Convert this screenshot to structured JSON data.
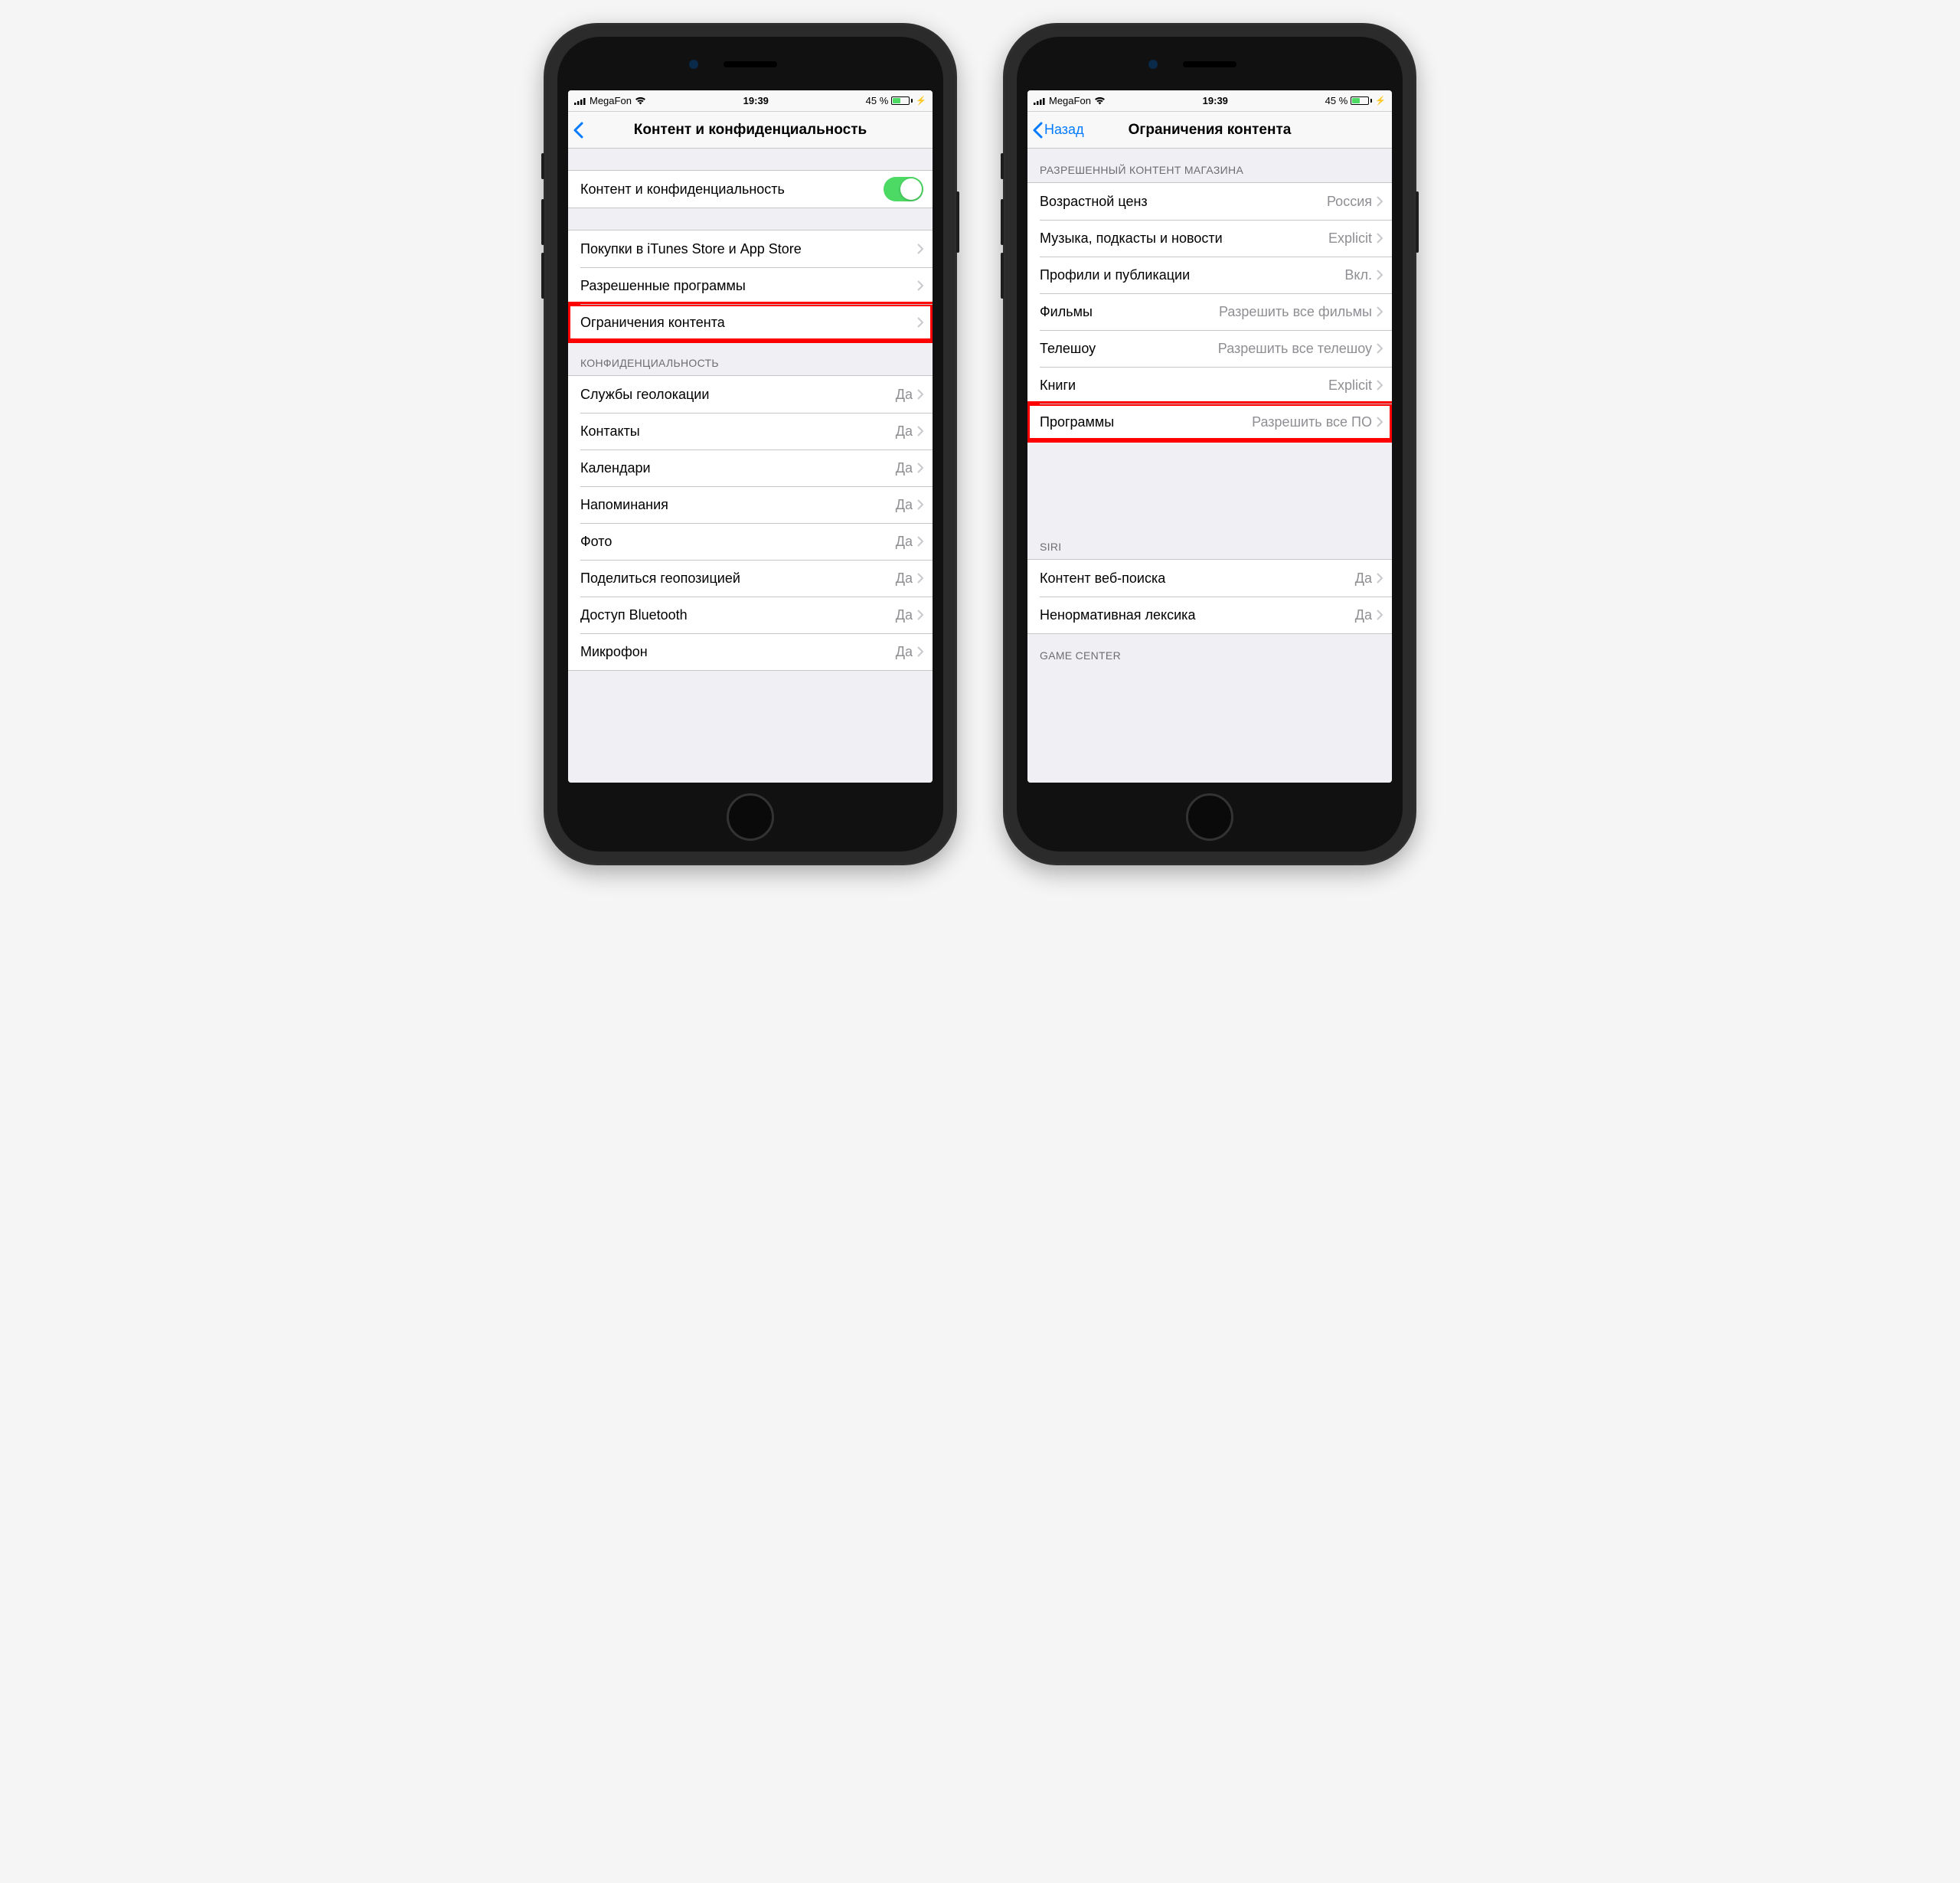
{
  "status": {
    "carrier": "MegaFon",
    "time": "19:39",
    "battery_pct": "45 %"
  },
  "phone1": {
    "nav": {
      "title": "Контент и конфиденциальность"
    },
    "toggle_row": {
      "label": "Контент и конфиденциальность"
    },
    "group2": [
      {
        "label": "Покупки в iTunes Store и App Store"
      },
      {
        "label": "Разрешенные программы"
      },
      {
        "label": "Ограничения контента",
        "highlight": true
      }
    ],
    "privacy_header": "КОНФИДЕНЦИАЛЬНОСТЬ",
    "privacy_rows": [
      {
        "label": "Службы геолокации",
        "value": "Да"
      },
      {
        "label": "Контакты",
        "value": "Да"
      },
      {
        "label": "Календари",
        "value": "Да"
      },
      {
        "label": "Напоминания",
        "value": "Да"
      },
      {
        "label": "Фото",
        "value": "Да"
      },
      {
        "label": "Поделиться геопозицией",
        "value": "Да"
      },
      {
        "label": "Доступ Bluetooth",
        "value": "Да"
      },
      {
        "label": "Микрофон",
        "value": "Да"
      }
    ]
  },
  "phone2": {
    "nav": {
      "back": "Назад",
      "title": "Ограничения контента"
    },
    "store_header": "РАЗРЕШЕННЫЙ КОНТЕНТ МАГАЗИНА",
    "store_rows": [
      {
        "label": "Возрастной ценз",
        "value": "Россия"
      },
      {
        "label": "Музыка, подкасты и новости",
        "value": "Explicit"
      },
      {
        "label": "Профили и публикации",
        "value": "Вкл."
      },
      {
        "label": "Фильмы",
        "value": "Разрешить все фильмы"
      },
      {
        "label": "Телешоу",
        "value": "Разрешить все телешоу"
      },
      {
        "label": "Книги",
        "value": "Explicit"
      },
      {
        "label": "Программы",
        "value": "Разрешить все ПО",
        "highlight": true
      }
    ],
    "siri_header": "SIRI",
    "siri_rows": [
      {
        "label": "Контент веб-поиска",
        "value": "Да"
      },
      {
        "label": "Ненормативная лексика",
        "value": "Да"
      }
    ],
    "gc_header": "GAME CENTER"
  }
}
